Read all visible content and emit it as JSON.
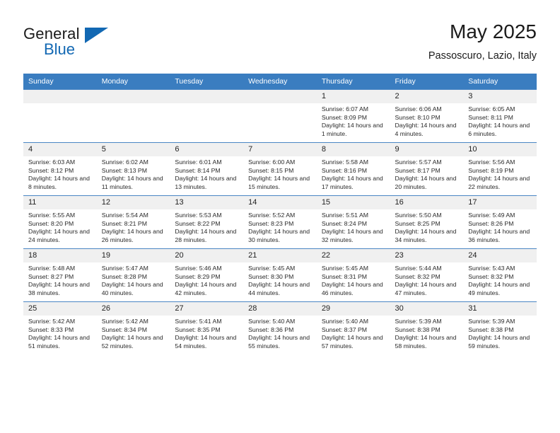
{
  "brand": {
    "name_top": "General",
    "name_bottom": "Blue",
    "accent_color": "#1268b3"
  },
  "header": {
    "title": "May 2025",
    "subtitle": "Passoscuro, Lazio, Italy"
  },
  "calendar": {
    "header_color": "#3a7dc0",
    "daynum_bg": "#f0f0f0",
    "weekday_headers": [
      "Sunday",
      "Monday",
      "Tuesday",
      "Wednesday",
      "Thursday",
      "Friday",
      "Saturday"
    ],
    "weeks": [
      [
        {
          "day": "",
          "empty": true
        },
        {
          "day": "",
          "empty": true
        },
        {
          "day": "",
          "empty": true
        },
        {
          "day": "",
          "empty": true
        },
        {
          "day": "1",
          "sunrise": "Sunrise: 6:07 AM",
          "sunset": "Sunset: 8:09 PM",
          "daylight": "Daylight: 14 hours and 1 minute."
        },
        {
          "day": "2",
          "sunrise": "Sunrise: 6:06 AM",
          "sunset": "Sunset: 8:10 PM",
          "daylight": "Daylight: 14 hours and 4 minutes."
        },
        {
          "day": "3",
          "sunrise": "Sunrise: 6:05 AM",
          "sunset": "Sunset: 8:11 PM",
          "daylight": "Daylight: 14 hours and 6 minutes."
        }
      ],
      [
        {
          "day": "4",
          "sunrise": "Sunrise: 6:03 AM",
          "sunset": "Sunset: 8:12 PM",
          "daylight": "Daylight: 14 hours and 8 minutes."
        },
        {
          "day": "5",
          "sunrise": "Sunrise: 6:02 AM",
          "sunset": "Sunset: 8:13 PM",
          "daylight": "Daylight: 14 hours and 11 minutes."
        },
        {
          "day": "6",
          "sunrise": "Sunrise: 6:01 AM",
          "sunset": "Sunset: 8:14 PM",
          "daylight": "Daylight: 14 hours and 13 minutes."
        },
        {
          "day": "7",
          "sunrise": "Sunrise: 6:00 AM",
          "sunset": "Sunset: 8:15 PM",
          "daylight": "Daylight: 14 hours and 15 minutes."
        },
        {
          "day": "8",
          "sunrise": "Sunrise: 5:58 AM",
          "sunset": "Sunset: 8:16 PM",
          "daylight": "Daylight: 14 hours and 17 minutes."
        },
        {
          "day": "9",
          "sunrise": "Sunrise: 5:57 AM",
          "sunset": "Sunset: 8:17 PM",
          "daylight": "Daylight: 14 hours and 20 minutes."
        },
        {
          "day": "10",
          "sunrise": "Sunrise: 5:56 AM",
          "sunset": "Sunset: 8:19 PM",
          "daylight": "Daylight: 14 hours and 22 minutes."
        }
      ],
      [
        {
          "day": "11",
          "sunrise": "Sunrise: 5:55 AM",
          "sunset": "Sunset: 8:20 PM",
          "daylight": "Daylight: 14 hours and 24 minutes."
        },
        {
          "day": "12",
          "sunrise": "Sunrise: 5:54 AM",
          "sunset": "Sunset: 8:21 PM",
          "daylight": "Daylight: 14 hours and 26 minutes."
        },
        {
          "day": "13",
          "sunrise": "Sunrise: 5:53 AM",
          "sunset": "Sunset: 8:22 PM",
          "daylight": "Daylight: 14 hours and 28 minutes."
        },
        {
          "day": "14",
          "sunrise": "Sunrise: 5:52 AM",
          "sunset": "Sunset: 8:23 PM",
          "daylight": "Daylight: 14 hours and 30 minutes."
        },
        {
          "day": "15",
          "sunrise": "Sunrise: 5:51 AM",
          "sunset": "Sunset: 8:24 PM",
          "daylight": "Daylight: 14 hours and 32 minutes."
        },
        {
          "day": "16",
          "sunrise": "Sunrise: 5:50 AM",
          "sunset": "Sunset: 8:25 PM",
          "daylight": "Daylight: 14 hours and 34 minutes."
        },
        {
          "day": "17",
          "sunrise": "Sunrise: 5:49 AM",
          "sunset": "Sunset: 8:26 PM",
          "daylight": "Daylight: 14 hours and 36 minutes."
        }
      ],
      [
        {
          "day": "18",
          "sunrise": "Sunrise: 5:48 AM",
          "sunset": "Sunset: 8:27 PM",
          "daylight": "Daylight: 14 hours and 38 minutes."
        },
        {
          "day": "19",
          "sunrise": "Sunrise: 5:47 AM",
          "sunset": "Sunset: 8:28 PM",
          "daylight": "Daylight: 14 hours and 40 minutes."
        },
        {
          "day": "20",
          "sunrise": "Sunrise: 5:46 AM",
          "sunset": "Sunset: 8:29 PM",
          "daylight": "Daylight: 14 hours and 42 minutes."
        },
        {
          "day": "21",
          "sunrise": "Sunrise: 5:45 AM",
          "sunset": "Sunset: 8:30 PM",
          "daylight": "Daylight: 14 hours and 44 minutes."
        },
        {
          "day": "22",
          "sunrise": "Sunrise: 5:45 AM",
          "sunset": "Sunset: 8:31 PM",
          "daylight": "Daylight: 14 hours and 46 minutes."
        },
        {
          "day": "23",
          "sunrise": "Sunrise: 5:44 AM",
          "sunset": "Sunset: 8:32 PM",
          "daylight": "Daylight: 14 hours and 47 minutes."
        },
        {
          "day": "24",
          "sunrise": "Sunrise: 5:43 AM",
          "sunset": "Sunset: 8:32 PM",
          "daylight": "Daylight: 14 hours and 49 minutes."
        }
      ],
      [
        {
          "day": "25",
          "sunrise": "Sunrise: 5:42 AM",
          "sunset": "Sunset: 8:33 PM",
          "daylight": "Daylight: 14 hours and 51 minutes."
        },
        {
          "day": "26",
          "sunrise": "Sunrise: 5:42 AM",
          "sunset": "Sunset: 8:34 PM",
          "daylight": "Daylight: 14 hours and 52 minutes."
        },
        {
          "day": "27",
          "sunrise": "Sunrise: 5:41 AM",
          "sunset": "Sunset: 8:35 PM",
          "daylight": "Daylight: 14 hours and 54 minutes."
        },
        {
          "day": "28",
          "sunrise": "Sunrise: 5:40 AM",
          "sunset": "Sunset: 8:36 PM",
          "daylight": "Daylight: 14 hours and 55 minutes."
        },
        {
          "day": "29",
          "sunrise": "Sunrise: 5:40 AM",
          "sunset": "Sunset: 8:37 PM",
          "daylight": "Daylight: 14 hours and 57 minutes."
        },
        {
          "day": "30",
          "sunrise": "Sunrise: 5:39 AM",
          "sunset": "Sunset: 8:38 PM",
          "daylight": "Daylight: 14 hours and 58 minutes."
        },
        {
          "day": "31",
          "sunrise": "Sunrise: 5:39 AM",
          "sunset": "Sunset: 8:38 PM",
          "daylight": "Daylight: 14 hours and 59 minutes."
        }
      ]
    ]
  }
}
